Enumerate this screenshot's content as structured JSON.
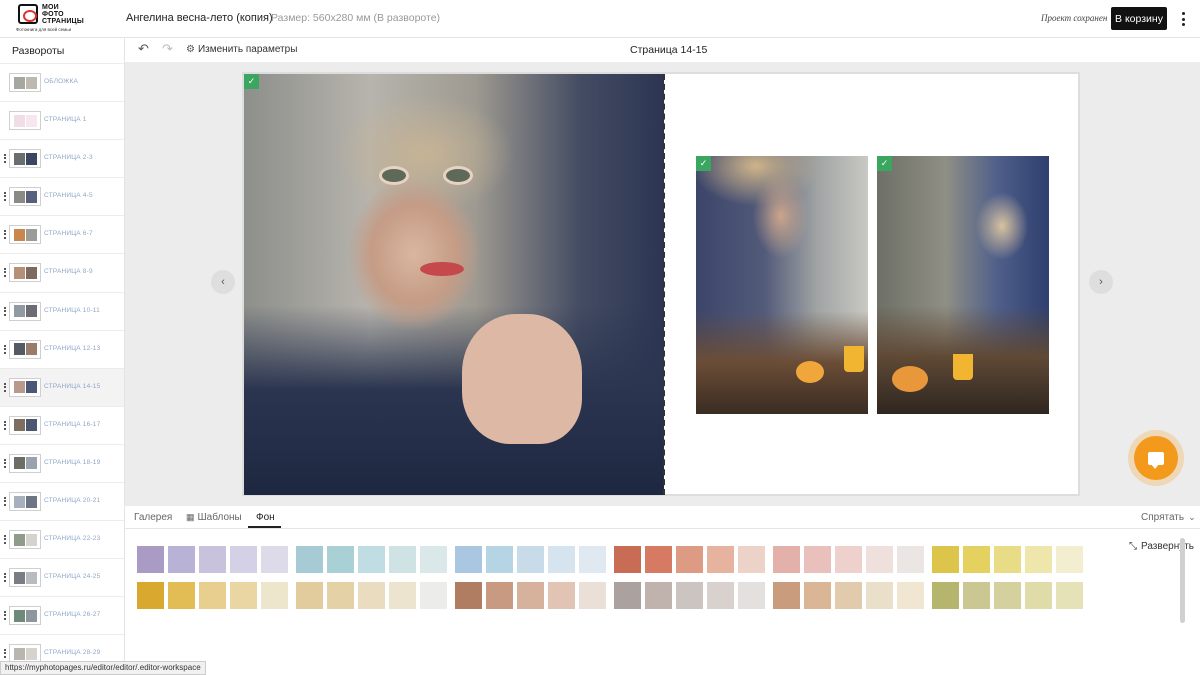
{
  "header": {
    "logo_text": "МОИ\nФОТО\nСТРАНИЦЫ",
    "logo_tagline": "Фотокнига для всей семьи",
    "project_title": "Ангелина весна-лето (копия)",
    "project_size": "Размер: 560x280 мм (В развороте)",
    "saved_status": "Проект сохранен",
    "cart_label": "В корзину"
  },
  "sidebar": {
    "title": "Развороты",
    "items": [
      {
        "label": "ОБЛОЖКА",
        "thumb": [
          "#a7a7a2",
          "#bdb8b0"
        ]
      },
      {
        "label": "СТРАНИЦА 1",
        "thumb": [
          "#f0dde6",
          "#f7e6ee"
        ]
      },
      {
        "label": "СТРАНИЦА 2-3",
        "thumb": [
          "#6b6e6e",
          "#3d4660"
        ]
      },
      {
        "label": "СТРАНИЦА 4-5",
        "thumb": [
          "#8a8a86",
          "#56607c"
        ]
      },
      {
        "label": "СТРАНИЦА 6-7",
        "thumb": [
          "#c9864f",
          "#9a9c98"
        ]
      },
      {
        "label": "СТРАНИЦА 8-9",
        "thumb": [
          "#b68f77",
          "#7c6a5f"
        ]
      },
      {
        "label": "СТРАНИЦА 10-11",
        "thumb": [
          "#8f9aa4",
          "#6d6c74"
        ]
      },
      {
        "label": "СТРАНИЦА 12-13",
        "thumb": [
          "#555a64",
          "#9b7b6a"
        ]
      },
      {
        "label": "СТРАНИЦА 14-15",
        "thumb": [
          "#b79a89",
          "#4c5677"
        ]
      },
      {
        "label": "СТРАНИЦА 16-17",
        "thumb": [
          "#7d6e60",
          "#4a5672"
        ]
      },
      {
        "label": "СТРАНИЦА 18-19",
        "thumb": [
          "#6e6c66",
          "#9aa3ad"
        ]
      },
      {
        "label": "СТРАНИЦА 20-21",
        "thumb": [
          "#a7b0bc",
          "#6b7584"
        ]
      },
      {
        "label": "СТРАНИЦА 22-23",
        "thumb": [
          "#8f9c8a",
          "#d4d3cd"
        ]
      },
      {
        "label": "СТРАНИЦА 24-25",
        "thumb": [
          "#7a7e84",
          "#b9bcbf"
        ]
      },
      {
        "label": "СТРАНИЦА 26-27",
        "thumb": [
          "#6f8a78",
          "#8d969c"
        ]
      },
      {
        "label": "СТРАНИЦА 28-29",
        "thumb": [
          "#b9b6b0",
          "#d6d3cd"
        ]
      }
    ],
    "active_index": 8
  },
  "toolbar": {
    "change_params": "Изменить параметры",
    "page_title": "Страница 14-15"
  },
  "canvas": {
    "selected_check": "✓"
  },
  "bottom": {
    "tabs": [
      {
        "label": "Галерея"
      },
      {
        "label": "Шаблоны"
      },
      {
        "label": "Фон"
      }
    ],
    "active_tab": 2,
    "hide_label": "Спрятать",
    "expand_label": "Развернуть",
    "swatch_groups": [
      [
        "#a99bc4",
        "#b8b3d6",
        "#c8c2dc",
        "#d4d1e6",
        "#dddbe9"
      ],
      [
        "#a6cbd4",
        "#a8d0d5",
        "#c0dde3",
        "#cfe3e5",
        "#dbe8ea"
      ],
      [
        "#aac7e2",
        "#b5d5e5",
        "#c8dbe9",
        "#d6e4ef",
        "#e0e8f1"
      ],
      [
        "#c86c55",
        "#d77a63",
        "#dd9b83",
        "#e5b39e",
        "#edd3c7"
      ],
      [
        "#e3b1a9",
        "#e9c0bb",
        "#eed1cd",
        "#f0e0dd",
        "#ebe6e4"
      ],
      [
        "#dcc54a",
        "#e4d15f",
        "#e8dc87",
        "#efe6ab",
        "#f3eecf"
      ],
      [
        "#d9a92f",
        "#e2bc55",
        "#e8cf8f",
        "#ead6a2",
        "#ede5cc"
      ],
      [
        "#e2cb9d",
        "#e4d1a6",
        "#e9dcbf",
        "#ede4d0",
        "#ececea"
      ],
      [
        "#b17d62",
        "#c89a82",
        "#d6b29c",
        "#e2c4b5",
        "#ebe0d8"
      ],
      [
        "#aba29f",
        "#c0b3ad",
        "#ccc4c0",
        "#d8d1ce",
        "#e4e0dd"
      ],
      [
        "#c99c7d",
        "#dab697",
        "#e2cbad",
        "#eadfc9",
        "#f0e6d2"
      ],
      [
        "#b6b56e",
        "#cac793",
        "#d4d19e",
        "#dfdcaa",
        "#e6e2b8"
      ]
    ]
  },
  "status_bar": {
    "url": "https://myphotopages.ru/editor/editor/.editor-workspace"
  }
}
